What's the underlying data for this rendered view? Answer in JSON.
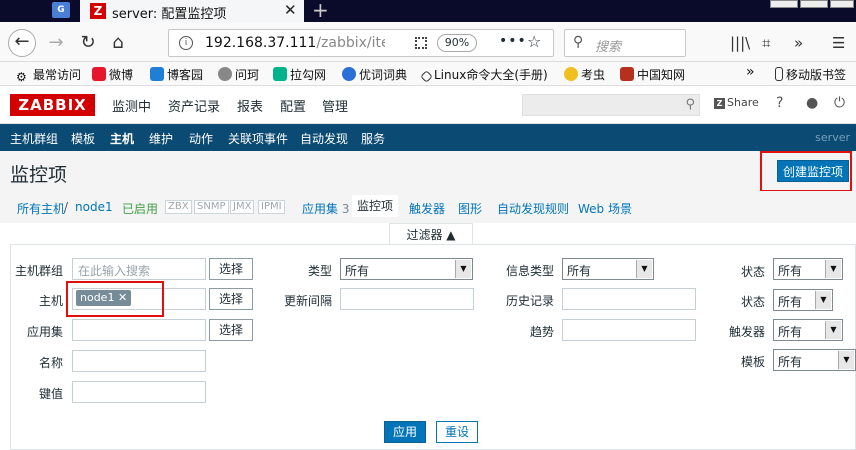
{
  "browser": {
    "tab_title": "server: 配置监控项",
    "url_main": "192.168.37.111",
    "url_path": "/zabbix/item",
    "zoom": "90%",
    "search_placeholder": "搜索"
  },
  "bookmarks": [
    {
      "label": "最常访问",
      "color": "#444"
    },
    {
      "label": "微博",
      "color": "#e6162d"
    },
    {
      "label": "博客园",
      "color": "#1f7fd6"
    },
    {
      "label": "问珂",
      "color": "#666"
    },
    {
      "label": "拉勾网",
      "color": "#00b38a"
    },
    {
      "label": "优词词典",
      "color": "#2a6fd6"
    },
    {
      "label": "Linux命令大全(手册)",
      "color": "#333"
    },
    {
      "label": "考虫",
      "color": "#f0c020"
    },
    {
      "label": "中国知网",
      "color": "#b5311e"
    }
  ],
  "mobile_bookmarks": "移动版书签",
  "zabbix": {
    "logo": "ZABBIX",
    "menu": [
      "监测中",
      "资产记录",
      "报表",
      "配置",
      "管理"
    ],
    "share": "Share",
    "submenu": [
      "主机群组",
      "模板",
      "主机",
      "维护",
      "动作",
      "关联项事件",
      "自动发现",
      "服务"
    ],
    "server_label": "server"
  },
  "page": {
    "title": "监控项",
    "create_button": "创建监控项"
  },
  "hostnav": {
    "all_hosts": "所有主机",
    "sep": "/",
    "host": "node1",
    "status": "已启用",
    "protocols": [
      "ZBX",
      "SNMP",
      "JMX",
      "IPMI"
    ],
    "applications": "应用集",
    "applications_count": "3",
    "items": "监控项",
    "triggers": "触发器",
    "graphs": "图形",
    "discovery": "自动发现规则",
    "web": "Web 场景"
  },
  "filter": {
    "tab_label": "过滤器 ▲",
    "host_group_label": "主机群组",
    "host_group_placeholder": "在此输入搜索",
    "host_label": "主机",
    "host_tag": "node1",
    "application_label": "应用集",
    "name_label": "名称",
    "key_label": "键值",
    "select_button": "选择",
    "type_label": "类型",
    "type_value": "所有",
    "interval_label": "更新间隔",
    "info_type_label": "信息类型",
    "info_type_value": "所有",
    "history_label": "历史记录",
    "trend_label": "趋势",
    "status_label": "状态",
    "status_value": "所有",
    "state_label": "状态",
    "state_value": "所有",
    "trigger_label": "触发器",
    "trigger_value": "所有",
    "template_label": "模板",
    "template_value": "所有",
    "apply_button": "应用",
    "reset_button": "重设"
  }
}
